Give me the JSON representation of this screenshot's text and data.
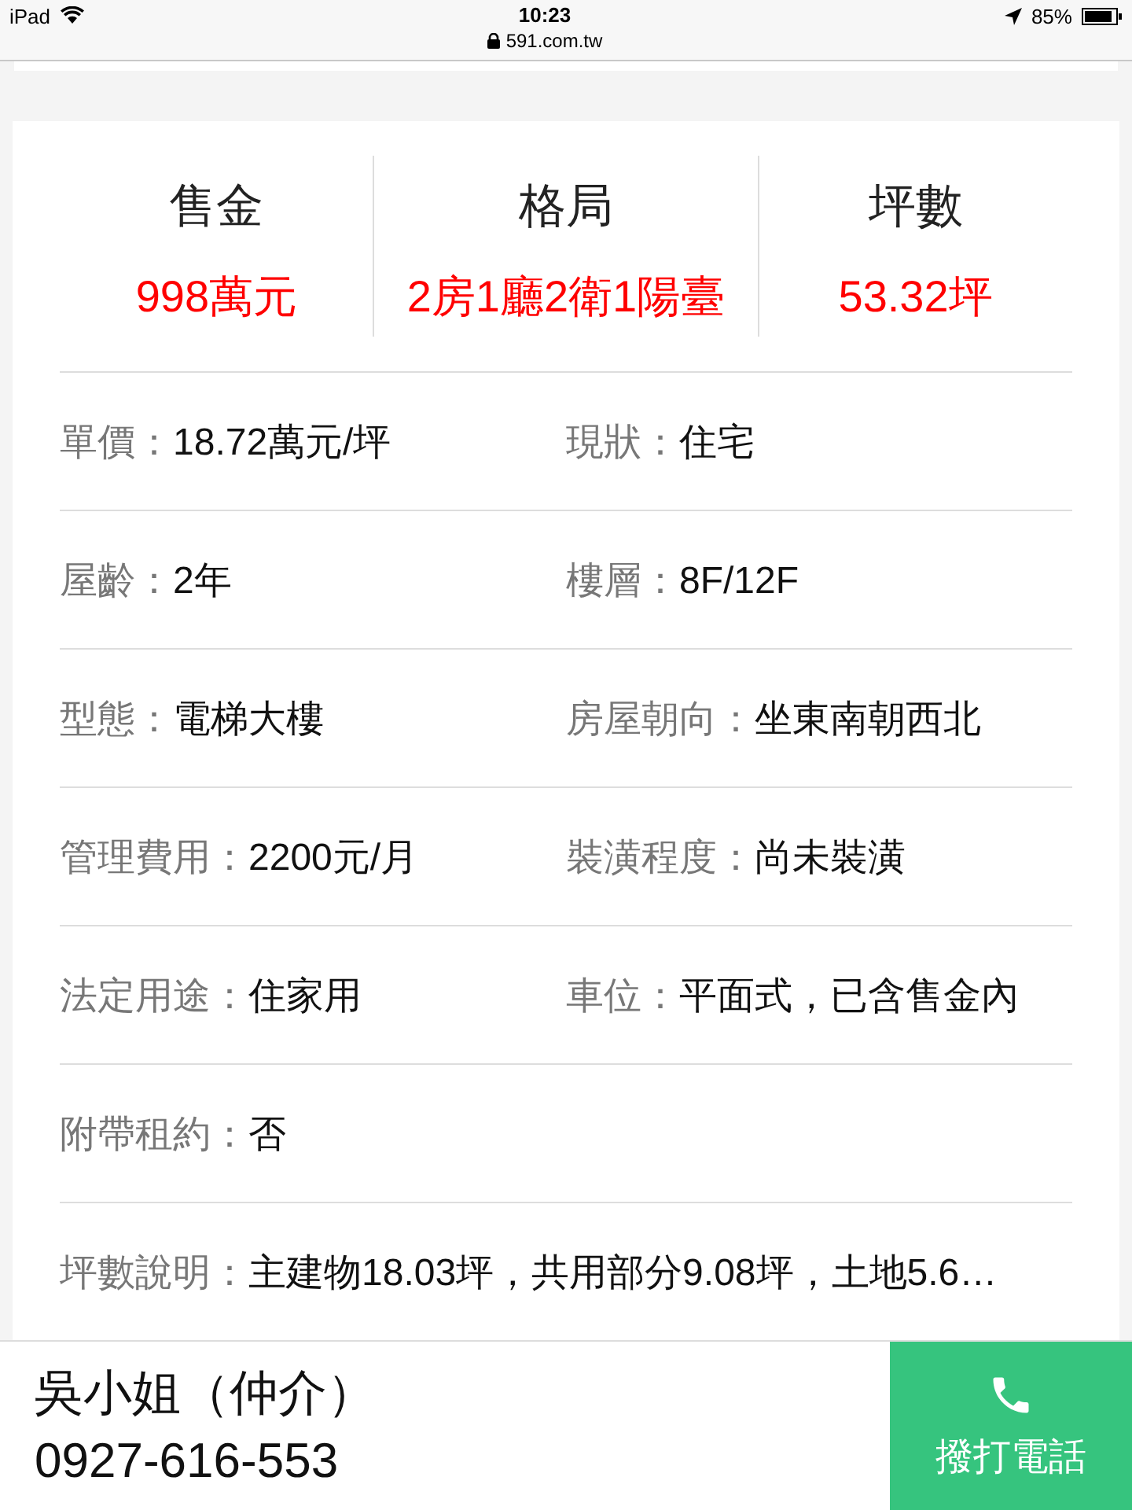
{
  "status_bar": {
    "device": "iPad",
    "time": "10:23",
    "url": "591.com.tw",
    "battery": "85%"
  },
  "summary": [
    {
      "label": "售金",
      "value": "998萬元"
    },
    {
      "label": "格局",
      "value": "2房1廳2衛1陽臺"
    },
    {
      "label": "坪數",
      "value": "53.32坪"
    }
  ],
  "details": [
    [
      {
        "label": "單價：",
        "value": "18.72萬元/坪"
      },
      {
        "label": "現狀：",
        "value": "住宅"
      }
    ],
    [
      {
        "label": "屋齡：",
        "value": "2年"
      },
      {
        "label": "樓層：",
        "value": "8F/12F"
      }
    ],
    [
      {
        "label": "型態：",
        "value": "電梯大樓"
      },
      {
        "label": "房屋朝向：",
        "value": "坐東南朝西北"
      }
    ],
    [
      {
        "label": "管理費用：",
        "value": "2200元/月"
      },
      {
        "label": "裝潢程度：",
        "value": "尚未裝潢"
      }
    ],
    [
      {
        "label": "法定用途：",
        "value": "住家用"
      },
      {
        "label": "車位：",
        "value": "平面式，已含售金內"
      }
    ],
    [
      {
        "label": "附帶租約：",
        "value": "否"
      }
    ],
    [
      {
        "label": "坪數說明：",
        "value": "主建物18.03坪，共用部分9.08坪，土地5.6…"
      }
    ]
  ],
  "contact": {
    "name": "吳小姐（仲介）",
    "phone": "0927-616-553",
    "call_button": "撥打電話"
  }
}
